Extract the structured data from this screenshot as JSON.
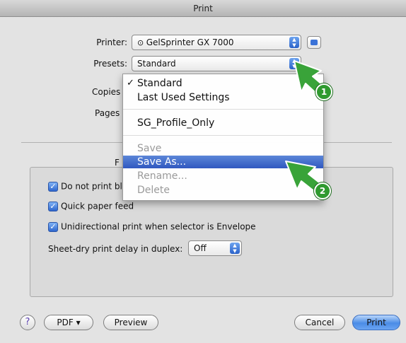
{
  "window": {
    "title": "Print"
  },
  "printer": {
    "label": "Printer:",
    "value": "GelSprinter GX 7000"
  },
  "presets": {
    "label": "Presets:",
    "value": "Standard"
  },
  "copies": {
    "label": "Copies"
  },
  "pages": {
    "label": "Pages"
  },
  "section": {
    "label": "F"
  },
  "options": [
    {
      "label": "Do not print bl",
      "checked": true
    },
    {
      "label": "Quick paper feed",
      "checked": true
    },
    {
      "label": "Unidirectional print when selector is Envelope",
      "checked": true
    }
  ],
  "duplex_delay": {
    "label": "Sheet-dry print delay in duplex:",
    "value": "Off"
  },
  "presets_menu": {
    "items": [
      {
        "label": "Standard",
        "checked": true,
        "enabled": true
      },
      {
        "label": "Last Used Settings",
        "checked": false,
        "enabled": true
      },
      {
        "label": "SG_Profile_Only",
        "checked": false,
        "enabled": true
      },
      {
        "label": "Save",
        "checked": false,
        "enabled": false
      },
      {
        "label": "Save As...",
        "checked": false,
        "enabled": true,
        "highlighted": true
      },
      {
        "label": "Rename...",
        "checked": false,
        "enabled": false
      },
      {
        "label": "Delete",
        "checked": false,
        "enabled": false
      }
    ]
  },
  "annotations": [
    {
      "number": "1",
      "color": "#2f9a2f"
    },
    {
      "number": "2",
      "color": "#2f9a2f"
    }
  ],
  "buttons": {
    "help": "?",
    "pdf": "PDF ▾",
    "preview": "Preview",
    "cancel": "Cancel",
    "print": "Print"
  },
  "colors": {
    "accent": "#3058c0",
    "annotation": "#2f9a2f"
  }
}
